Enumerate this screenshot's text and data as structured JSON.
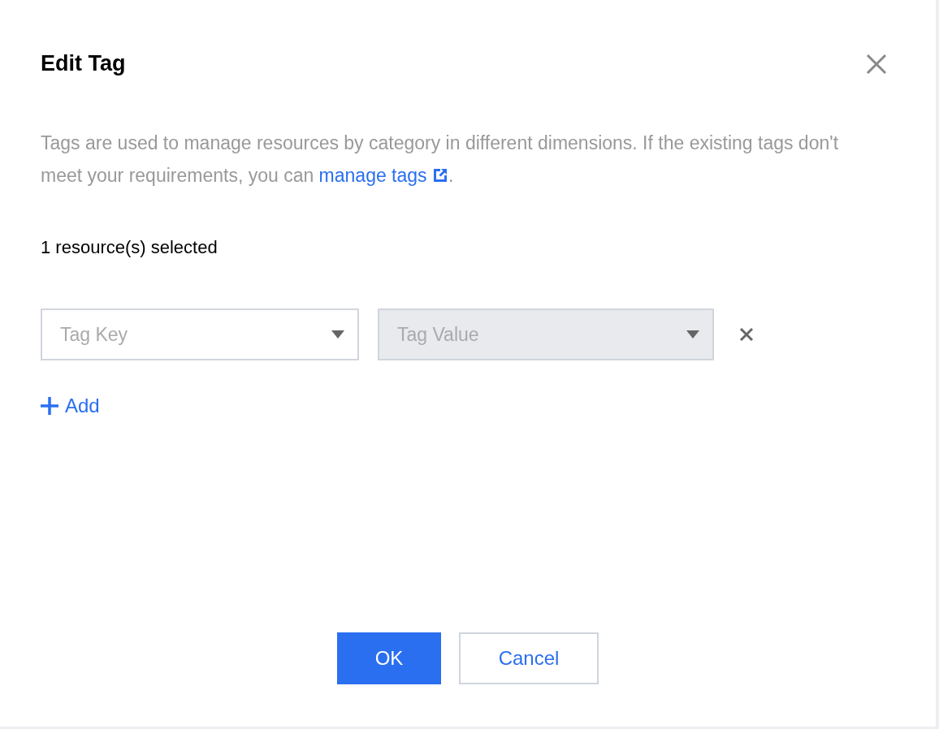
{
  "dialog": {
    "title": "Edit Tag",
    "description": {
      "text": "Tags are used to manage resources by category in different dimensions. If the existing tags don't meet your requirements, you can",
      "link": "manage tags",
      "suffix": "."
    },
    "selection_count": "1 resource(s) selected",
    "tag_rows": [
      {
        "key": {
          "placeholder": "Tag Key",
          "disabled": false
        },
        "value": {
          "placeholder": "Tag Value",
          "disabled": true
        }
      }
    ],
    "add_label": "Add",
    "buttons": [
      {
        "label": "OK",
        "kind": "primary"
      },
      {
        "label": "Cancel",
        "kind": "secondary"
      }
    ]
  }
}
